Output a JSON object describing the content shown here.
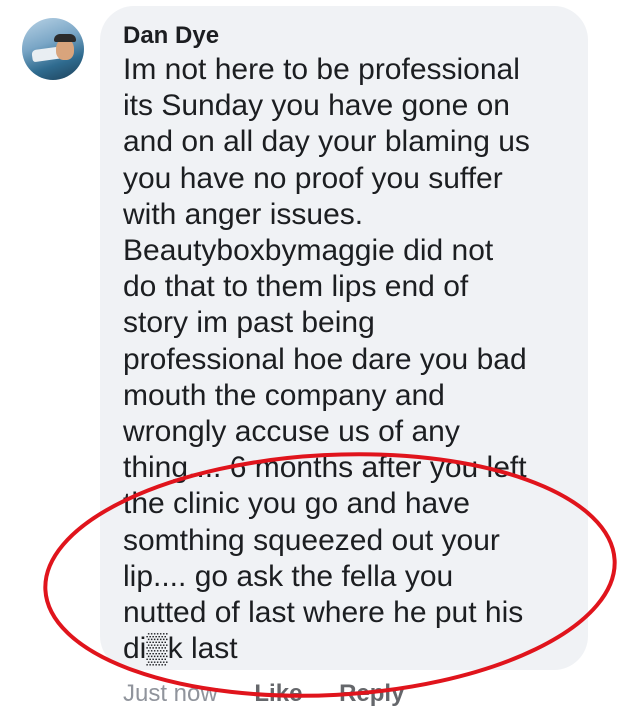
{
  "comment": {
    "author": "Dan Dye",
    "avatar_icon": "user-avatar-photo",
    "text": "Im not here to be professional\nits Sunday you have gone on\nand on all day your blaming us\nyou have no proof you suffer\nwith anger issues.\nBeautyboxbymaggie did not\ndo that to them lips end of\nstory im past being\nprofessional hoe dare you bad\nmouth the company and\nwrongly accuse us of any\nthing.... 6 months after you left\nthe clinic you go and have\nsomthing squeezed out your\nlip.... go ask the fella you\nnutted of last where he put his\ndi▒k last"
  },
  "actions": {
    "timestamp": "Just now",
    "like_label": "Like",
    "reply_label": "Reply"
  },
  "annotation": {
    "shape": "ellipse",
    "color": "#e0141c"
  }
}
